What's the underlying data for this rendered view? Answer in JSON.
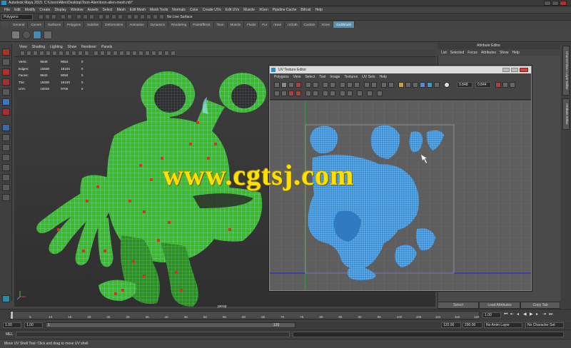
{
  "window": {
    "title": "Autodesk Maya 2015: C:\\Users\\Allen\\Desktop\\Toon-Alien\\toon-alien-mesh.mb*"
  },
  "menubar": [
    "File",
    "Edit",
    "Modify",
    "Create",
    "Display",
    "Window",
    "Assets",
    "Select",
    "Mesh",
    "Edit Mesh",
    "Mesh Tools",
    "Normals",
    "Color",
    "Create UVs",
    "Edit UVs",
    "Muscle",
    "XGen",
    "Pipeline Cache",
    "Bifrost",
    "Help"
  ],
  "statusline": {
    "mode": "Polygons",
    "live_surface": "No Live Surface"
  },
  "shelf_tabs": [
    {
      "label": "General",
      "active": false
    },
    {
      "label": "Curves",
      "active": false
    },
    {
      "label": "Surfaces",
      "active": false
    },
    {
      "label": "Polygons",
      "active": false
    },
    {
      "label": "Subdivs",
      "active": false
    },
    {
      "label": "Deformation",
      "active": false
    },
    {
      "label": "Animation",
      "active": false
    },
    {
      "label": "Dynamics",
      "active": false
    },
    {
      "label": "Rendering",
      "active": false
    },
    {
      "label": "PaintEffects",
      "active": false
    },
    {
      "label": "Toon",
      "active": false
    },
    {
      "label": "Muscle",
      "active": false
    },
    {
      "label": "Fluids",
      "active": false
    },
    {
      "label": "Fur",
      "active": false
    },
    {
      "label": "nHair",
      "active": false
    },
    {
      "label": "nCloth",
      "active": false
    },
    {
      "label": "Custom",
      "active": false
    },
    {
      "label": "XGen",
      "active": false
    },
    {
      "label": "GoZBrush",
      "active": true
    }
  ],
  "viewport": {
    "menu": [
      "View",
      "Shading",
      "Lighting",
      "Show",
      "Renderer",
      "Panels"
    ],
    "camera": "persp",
    "hud": [
      {
        "label": "Verts:",
        "a": "9648",
        "b": "9054",
        "c": "0"
      },
      {
        "label": "Edges:",
        "a": "19280",
        "b": "18100",
        "c": "0"
      },
      {
        "label": "Faces:",
        "a": "9640",
        "b": "9050",
        "c": "0"
      },
      {
        "label": "Tris:",
        "a": "19280",
        "b": "18100",
        "c": "0"
      },
      {
        "label": "UVs:",
        "a": "10020",
        "b": "9706",
        "c": "0"
      }
    ]
  },
  "attribute_editor": {
    "title": "Attribute Editor",
    "menu": [
      "List",
      "Selected",
      "Focus",
      "Attributes",
      "Show",
      "Help"
    ],
    "buttons": [
      "Select",
      "Load Attributes",
      "Copy Tab"
    ]
  },
  "side_tabs": [
    "Channel Box / Layer Editor",
    "Attribute Editor"
  ],
  "uv_editor": {
    "title": "UV Texture Editor",
    "menu": [
      "Polygons",
      "View",
      "Select",
      "Tool",
      "Image",
      "Textures",
      "UV Sets",
      "Help"
    ],
    "field1": "0.848",
    "field2": "0.844"
  },
  "time_slider": {
    "ticks": [
      "1",
      "5",
      "10",
      "15",
      "20",
      "25",
      "30",
      "35",
      "40",
      "45",
      "50",
      "55",
      "60",
      "65",
      "70",
      "75",
      "80",
      "85",
      "90",
      "95",
      "100",
      "105",
      "110",
      "115",
      "120"
    ],
    "current_frame": "1.00"
  },
  "range_slider": {
    "start": "1.00",
    "anim_start": "1.00",
    "range_left": "1",
    "range_right": "120",
    "anim_end": "120.00",
    "end": "200.00",
    "anim_layer": "No Anim Layer",
    "char_set": "No Character Set"
  },
  "mel": {
    "label": "MEL"
  },
  "helpline": "Move UV Shell Tool: Click and drag to move UV shell",
  "watermark": "www.cgtsj.com",
  "colors": {
    "model_green": "#3fb82c",
    "wire_cyan": "#8fe6f0",
    "spot_red": "#d2352a",
    "uv_blue": "#3a8fd6",
    "active_tab": "#5f8fa8"
  }
}
